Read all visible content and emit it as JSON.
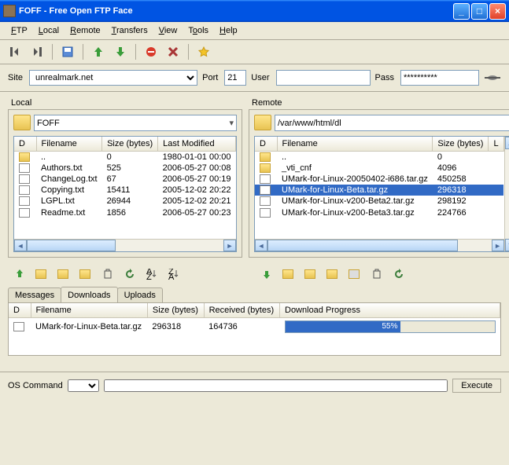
{
  "window": {
    "title": "FOFF - Free Open FTP Face"
  },
  "menu": {
    "ftp": "FTP",
    "local": "Local",
    "remote": "Remote",
    "transfers": "Transfers",
    "view": "View",
    "tools": "Tools",
    "help": "Help"
  },
  "conn": {
    "site_lbl": "Site",
    "site": "unrealmark.net",
    "port_lbl": "Port",
    "port": "21",
    "user_lbl": "User",
    "user": "",
    "pass_lbl": "Pass",
    "pass": "**********"
  },
  "local": {
    "label": "Local",
    "path": "FOFF",
    "cols": {
      "d": "D",
      "fn": "Filename",
      "sz": "Size (bytes)",
      "lm": "Last Modified"
    },
    "rows": [
      {
        "icon": "fold",
        "name": "..",
        "size": "0",
        "mod": "1980-01-01 00:00"
      },
      {
        "icon": "file",
        "name": "Authors.txt",
        "size": "525",
        "mod": "2006-05-27 00:08"
      },
      {
        "icon": "file",
        "name": "ChangeLog.txt",
        "size": "67",
        "mod": "2006-05-27 00:19"
      },
      {
        "icon": "file",
        "name": "Copying.txt",
        "size": "15411",
        "mod": "2005-12-02 20:22"
      },
      {
        "icon": "file",
        "name": "LGPL.txt",
        "size": "26944",
        "mod": "2005-12-02 20:21"
      },
      {
        "icon": "file",
        "name": "Readme.txt",
        "size": "1856",
        "mod": "2006-05-27 00:23"
      }
    ]
  },
  "remote": {
    "label": "Remote",
    "path": "/var/www/html/dl",
    "cols": {
      "d": "D",
      "fn": "Filename",
      "sz": "Size (bytes)",
      "l": "L"
    },
    "rows": [
      {
        "icon": "fold",
        "name": "..",
        "size": "0",
        "sel": false
      },
      {
        "icon": "fold",
        "name": "_vti_cnf",
        "size": "4096",
        "sel": false
      },
      {
        "icon": "file",
        "name": "UMark-for-Linux-20050402-i686.tar.gz",
        "size": "450258",
        "sel": false
      },
      {
        "icon": "file",
        "name": "UMark-for-Linux-Beta.tar.gz",
        "size": "296318",
        "sel": true
      },
      {
        "icon": "file",
        "name": "UMark-for-Linux-v200-Beta2.tar.gz",
        "size": "298192",
        "sel": false
      },
      {
        "icon": "file",
        "name": "UMark-for-Linux-v200-Beta3.tar.gz",
        "size": "224766",
        "sel": false
      }
    ]
  },
  "tabs": {
    "messages": "Messages",
    "downloads": "Downloads",
    "uploads": "Uploads"
  },
  "dl": {
    "cols": {
      "d": "D",
      "fn": "Filename",
      "sz": "Size (bytes)",
      "rcv": "Received (bytes)",
      "prog": "Download Progress"
    },
    "rows": [
      {
        "name": "UMark-for-Linux-Beta.tar.gz",
        "size": "296318",
        "recv": "164736",
        "pct": "55%"
      }
    ]
  },
  "cmd": {
    "label": "OS Command",
    "exec": "Execute"
  }
}
